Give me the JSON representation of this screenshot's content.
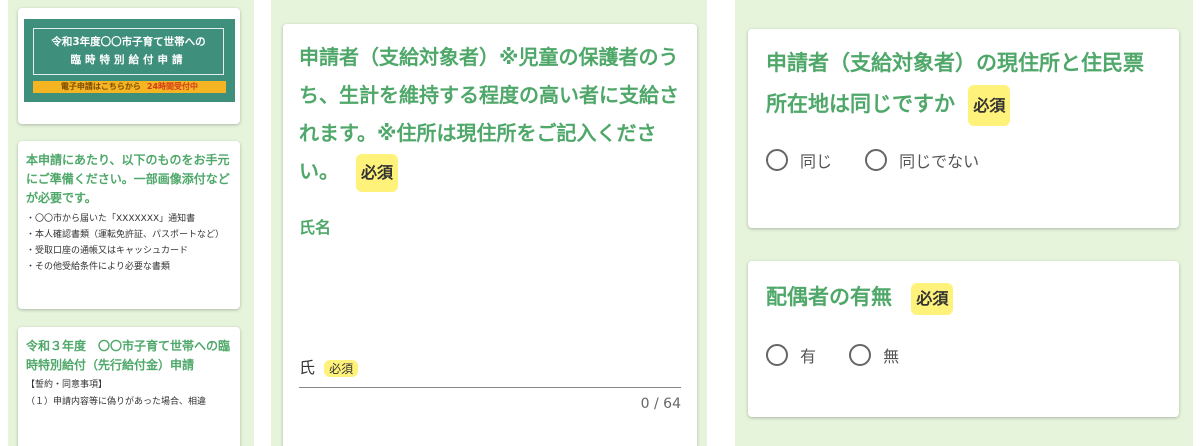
{
  "banner": {
    "line1": "令和3年度〇〇市子育て世帯への",
    "line2": "臨時特別給付申請",
    "strip_text": "電子申請はこちらから",
    "strip_highlight": "24時間受付中"
  },
  "prep_card": {
    "heading": "本申請にあたり、以下のものをお手元にご準備ください。一部画像添付などが必要です。",
    "items": [
      "・〇〇市から届いた「XXXXXXX」通知書",
      "・本人確認書類（運転免許証、パスポートなど）",
      "・受取口座の通帳又はキャッシュカード",
      "・その他受給条件により必要な書類"
    ]
  },
  "terms_card": {
    "heading": "令和３年度　〇〇市子育て世帯への臨時特別給付（先行給付金）申請",
    "subheading": "【誓約・同意事項】",
    "partial_line": "（１）申請内容等に偽りがあった場合、相違"
  },
  "applicant": {
    "heading": "申請者（支給対象者）※児童の保護者のうち、生計を維持する程度の高い者に支給されます。※住所は現住所をご記入ください。",
    "required_label": "必須",
    "name_label": "氏名",
    "field_prefix": "氏",
    "field_required": "必須",
    "counter": "0 / 64"
  },
  "address_question": {
    "heading": "申請者（支給対象者）の現住所と住民票所在地は同じですか",
    "required_label": "必須",
    "options": [
      "同じ",
      "同じでない"
    ]
  },
  "spouse_question": {
    "heading": "配偶者の有無",
    "required_label": "必須",
    "options": [
      "有",
      "無"
    ]
  }
}
